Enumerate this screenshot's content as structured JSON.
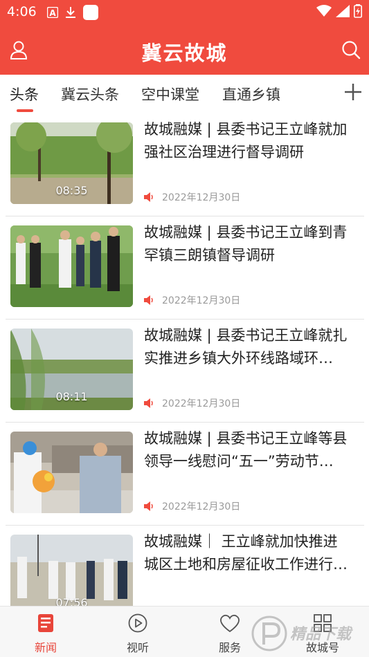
{
  "status_bar": {
    "time": "4:06",
    "icons_left": [
      "text-a-icon",
      "download-icon",
      "app-square-icon"
    ],
    "icons_right": [
      "wifi-icon",
      "signal-icon",
      "battery-charging-icon"
    ]
  },
  "header": {
    "title": "冀云故城",
    "left_icon": "user-icon",
    "right_icon": "search-icon",
    "bg_color": "#f04b3e"
  },
  "tabs": {
    "items": [
      {
        "label": "头条",
        "active": true
      },
      {
        "label": "冀云头条",
        "active": false
      },
      {
        "label": "空中课堂",
        "active": false
      },
      {
        "label": "直通乡镇",
        "active": false
      }
    ],
    "add_icon": "plus-icon",
    "indicator_color": "#f04b3e"
  },
  "news": [
    {
      "title": "故城融媒 | 县委书记王立峰就加强社区治理进行督导调研",
      "duration": "08:35",
      "date": "2022年12月30日",
      "audio_icon": "speaker-icon"
    },
    {
      "title": "故城融媒 | 县委书记王立峰到青罕镇三朗镇督导调研",
      "duration": "",
      "date": "2022年12月30日",
      "audio_icon": "speaker-icon"
    },
    {
      "title": "故城融媒 | 县委书记王立峰就扎实推进乡镇大外环线路域环…",
      "duration": "08:11",
      "date": "2022年12月30日",
      "audio_icon": "speaker-icon"
    },
    {
      "title": "故城融媒 | 县委书记王立峰等县领导一线慰问“五一”劳动节…",
      "duration": "",
      "date": "2022年12月30日",
      "audio_icon": "speaker-icon"
    },
    {
      "title": "故城融媒｜ 王立峰就加快推进城区土地和房屋征收工作进行…",
      "duration": "07:56",
      "date": "",
      "audio_icon": "speaker-icon"
    }
  ],
  "bottom_nav": {
    "items": [
      {
        "label": "新闻",
        "icon": "news-icon",
        "active": true
      },
      {
        "label": "视听",
        "icon": "play-circle-icon",
        "active": false
      },
      {
        "label": "服务",
        "icon": "heart-icon",
        "active": false
      },
      {
        "label": "故城号",
        "icon": "grid-icon",
        "active": false
      }
    ],
    "active_color": "#e8453a"
  },
  "watermark": {
    "text": "精品下载",
    "icon": "p-logo-icon"
  }
}
